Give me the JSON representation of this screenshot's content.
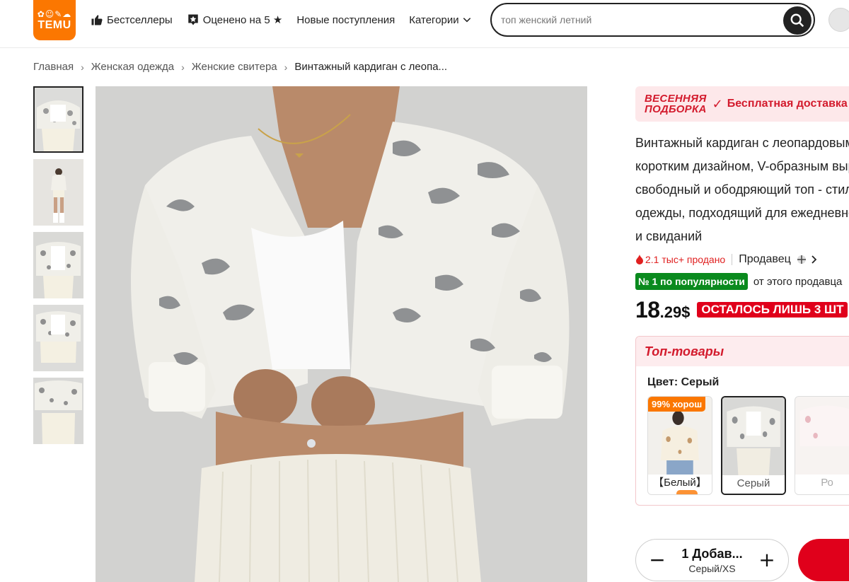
{
  "header": {
    "logo_glyphs": "✿☺✎☁",
    "logo_text": "TEMU",
    "nav": [
      {
        "label": "Бестселлеры",
        "icon": "thumbs-up-icon"
      },
      {
        "label": "Оценено на 5 ★",
        "icon": "star-badge-icon"
      },
      {
        "label": "Новые поступления",
        "icon": ""
      },
      {
        "label": "Категории",
        "icon": "chevron-down-icon"
      }
    ],
    "search_placeholder": "топ женский летний"
  },
  "breadcrumb": [
    "Главная",
    "Женская одежда",
    "Женские свитера",
    "Винтажный кардиган с леопа..."
  ],
  "product": {
    "promo_badge_line1": "ВЕСЕННЯЯ",
    "promo_badge_line2": "ПОДБОРКА",
    "promo_text": "Бесплатная доставка",
    "title_lines": [
      "Винтажный кардиган с леопардовым",
      "коротким дизайном, V-образным вырезом,",
      "свободный и ободряющий топ - стиль",
      "одежды, подходящий для ежедневной",
      "и свиданий"
    ],
    "sold": "2.1 тыс+ продано",
    "seller_label": "Продавец",
    "rank_badge": "№ 1 по популярности",
    "rank_text": "от этого продавца",
    "price_int": "18",
    "price_dec": ".29$",
    "stock_badge": "ОСТАЛОСЬ ЛИШЬ 3 ШТ",
    "top_goods": "Топ-товары",
    "color_label": "Цвет:",
    "color_value": "Серый",
    "swatches": [
      {
        "label": "【Белый】",
        "tag": "99% хорош"
      },
      {
        "label": "Серый",
        "tag": ""
      },
      {
        "label": "Ро",
        "tag": ""
      }
    ],
    "qty_main": "1 Добав...",
    "qty_sub": "Серый/XS",
    "qty_minus": "−",
    "qty_plus": "+"
  },
  "colors": {
    "brand": "#fb7701",
    "accent_red": "#e0001b",
    "rank_green": "#0a8a1e"
  }
}
